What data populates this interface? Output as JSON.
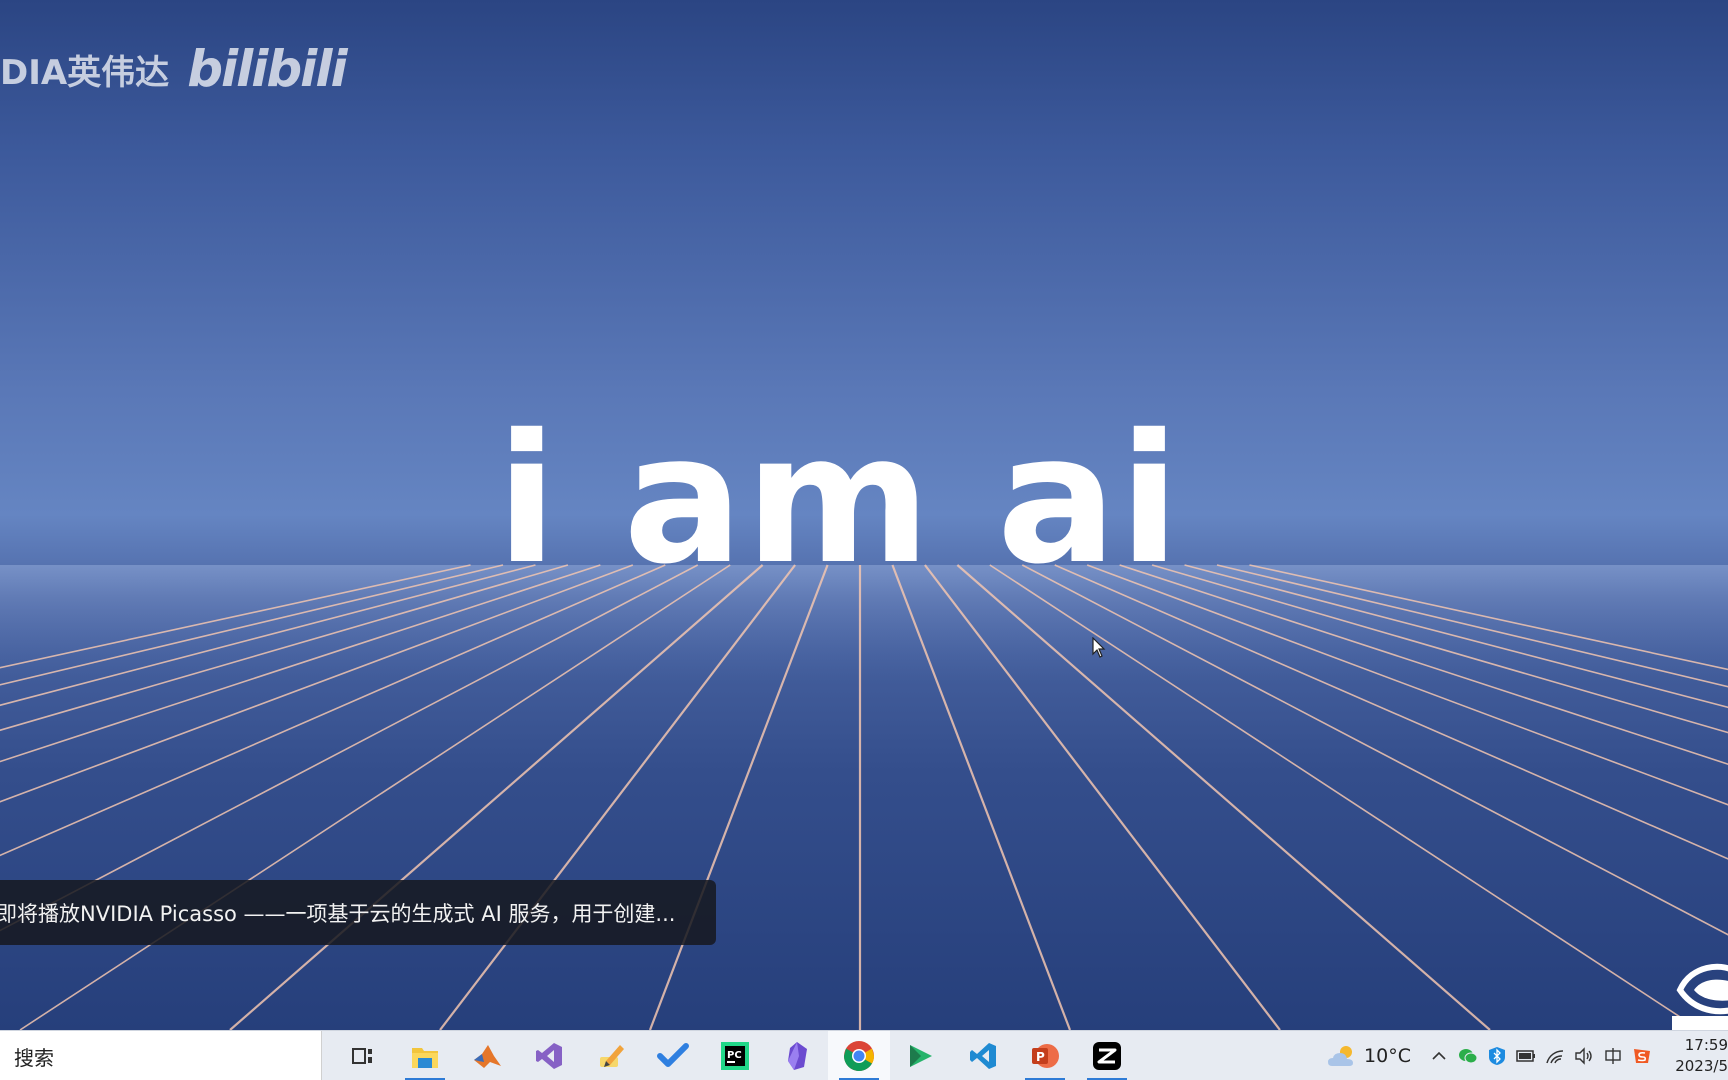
{
  "video": {
    "watermark_text": "DIA英伟达",
    "watermark_logo": "bilibili",
    "headline": "i am ai",
    "caption": "即将播放NVIDIA Picasso ——一项基于云的生成式 AI 服务，用于创建..."
  },
  "taskbar": {
    "search_label": "搜索",
    "apps": [
      {
        "name": "task-view-icon",
        "active": false
      },
      {
        "name": "file-explorer-icon",
        "active": false
      },
      {
        "name": "matlab-icon",
        "active": false
      },
      {
        "name": "visual-studio-icon",
        "active": false
      },
      {
        "name": "notes-pen-icon",
        "active": false
      },
      {
        "name": "todo-check-icon",
        "active": false
      },
      {
        "name": "pycharm-icon",
        "active": false
      },
      {
        "name": "obsidian-icon",
        "active": false
      },
      {
        "name": "chrome-icon",
        "active": true
      },
      {
        "name": "media-player-icon",
        "active": false
      },
      {
        "name": "vscode-icon",
        "active": false
      },
      {
        "name": "powerpoint-icon",
        "active": false
      },
      {
        "name": "capcut-icon",
        "active": false
      }
    ],
    "weather_temp": "10°C",
    "clock_time": "17:59",
    "clock_date": "2023/5"
  },
  "colors": {
    "sky_top": "#2b4583",
    "horizon": "#6585c2",
    "grid_line": "#f2c6b0",
    "taskbar_bg": "#e7ebf2",
    "active_indicator": "#2e7bd6"
  }
}
